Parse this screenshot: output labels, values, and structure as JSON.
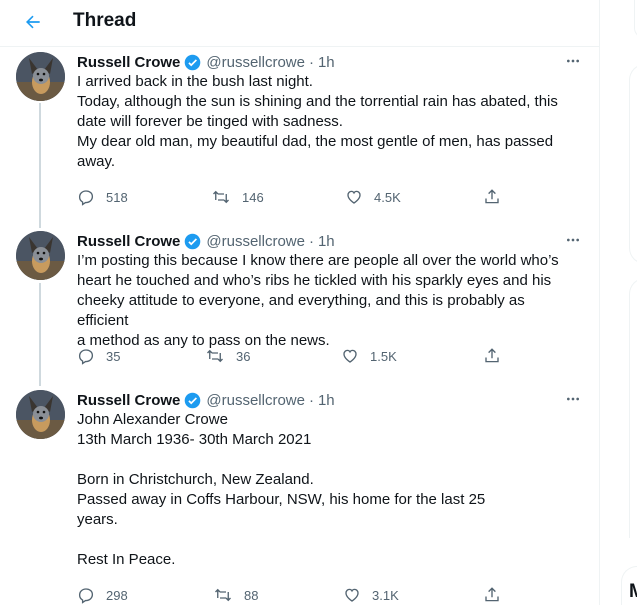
{
  "header": {
    "title": "Thread"
  },
  "tweets": [
    {
      "author": "Russell Crowe",
      "handle": "@russellcrowe",
      "separator": "·",
      "time": "1h",
      "lines": [
        "I arrived back in the bush last night.",
        "Today, although the sun is shining and the torrential rain has abated, this",
        "date will forever be tinged with sadness.",
        "My dear old man, my beautiful dad, the most gentle of men, has passed",
        "away."
      ],
      "replies": "518",
      "retweets": "146",
      "likes": "4.5K"
    },
    {
      "author": "Russell Crowe",
      "handle": "@russellcrowe",
      "separator": "·",
      "time": "1h",
      "lines": [
        "I’m posting this because I know there are people all over the world who’s",
        "heart he touched and who’s ribs he tickled with his sparkly eyes and his",
        "cheeky attitude to everyone, and everything, and this is probably as efficient",
        "a method as any to pass on the news."
      ],
      "replies": "35",
      "retweets": "36",
      "likes": "1.5K"
    },
    {
      "author": "Russell Crowe",
      "handle": "@russellcrowe",
      "separator": "·",
      "time": "1h",
      "lines": [
        "John Alexander Crowe",
        "13th March 1936- 30th March 2021",
        "",
        "Born in Christchurch, New Zealand.",
        "Passed away in Coffs Harbour, NSW,  his home for the last 25",
        "years.",
        "",
        "Rest In Peace."
      ],
      "replies": "298",
      "retweets": "88",
      "likes": "3.1K"
    }
  ],
  "right_rail": {
    "partial_heading": "M"
  },
  "colors": {
    "accent": "#1d9bf0",
    "text": "#0f1419",
    "secondary": "#536471",
    "border": "#eff3f4",
    "thread_line": "#cfd9de"
  },
  "icons": {
    "back": "arrow-left-icon",
    "verified": "verified-badge-icon",
    "more": "more-horizontal-icon",
    "reply": "reply-icon",
    "retweet": "retweet-icon",
    "like": "heart-icon",
    "share": "share-icon"
  }
}
